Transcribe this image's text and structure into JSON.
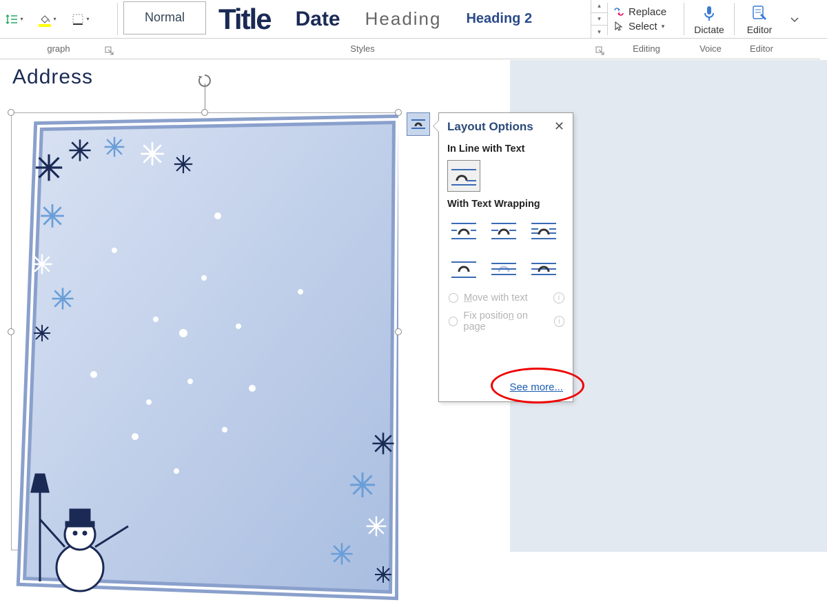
{
  "ribbon": {
    "styles": {
      "normal": "Normal",
      "title": "Title",
      "date": "Date",
      "heading": "Heading",
      "heading2": "Heading 2"
    },
    "editing": {
      "replace": "Replace",
      "select": "Select"
    },
    "dictate": "Dictate",
    "editor": "Editor",
    "groups": {
      "paragraph": "graph",
      "styles": "Styles",
      "editing": "Editing",
      "voice": "Voice",
      "editor": "Editor"
    }
  },
  "document": {
    "address_heading": "Address"
  },
  "layout_options": {
    "title": "Layout Options",
    "inline_label": "In Line with Text",
    "wrap_label": "With Text Wrapping",
    "move_with_text_pre": "M",
    "move_with_text_rest": "ove with text",
    "fix_pos_pre": "Fix positio",
    "fix_pos_under": "n",
    "fix_pos_rest": " on page",
    "see_more": "See more..."
  }
}
